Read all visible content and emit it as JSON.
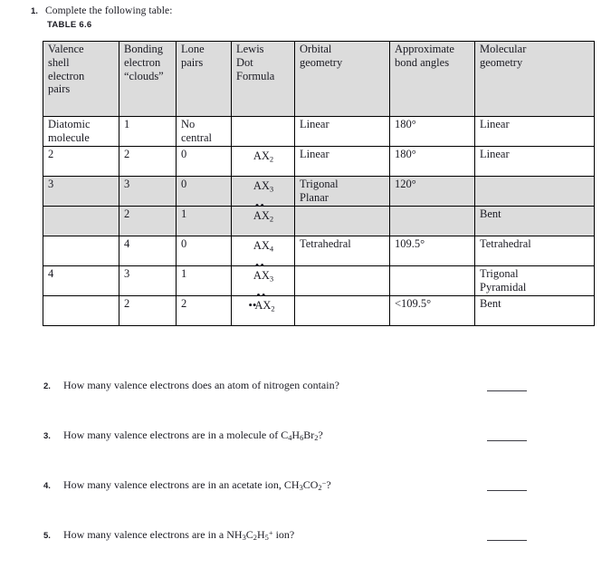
{
  "question1": {
    "number": "1.",
    "prompt": "Complete the following table:",
    "table_caption": "TABLE 6.6"
  },
  "table": {
    "headers": [
      [
        "Valence",
        "shell",
        "electron",
        "pairs"
      ],
      [
        "Bonding",
        "electron",
        "“clouds”"
      ],
      [
        "Lone",
        "pairs"
      ],
      [
        "Lewis",
        "Dot",
        "Formula"
      ],
      [
        "Orbital",
        "geometry"
      ],
      [
        "Approximate",
        "bond angles"
      ],
      [
        "Molecular",
        "geometry"
      ]
    ],
    "rows": [
      {
        "shaded": false,
        "valence_shell_pairs": [
          "Diatomic",
          "molecule"
        ],
        "bonding_clouds": [
          "1"
        ],
        "lone_pairs": [
          "No",
          "central"
        ],
        "lewis": {
          "left_dots": "",
          "top_dots": "",
          "core": "",
          "sub": ""
        },
        "orbital_geometry": [
          "Linear"
        ],
        "bond_angles": [
          "180°"
        ],
        "molecular_geometry": [
          "Linear"
        ]
      },
      {
        "shaded": false,
        "valence_shell_pairs": [
          "2"
        ],
        "bonding_clouds": [
          "2"
        ],
        "lone_pairs": [
          "0"
        ],
        "lewis": {
          "left_dots": "",
          "top_dots": "",
          "core": "AX",
          "sub": "2"
        },
        "orbital_geometry": [
          "Linear"
        ],
        "bond_angles": [
          "180°"
        ],
        "molecular_geometry": [
          "Linear"
        ]
      },
      {
        "shaded": true,
        "valence_shell_pairs": [
          "3"
        ],
        "bonding_clouds": [
          "3"
        ],
        "lone_pairs": [
          "0"
        ],
        "lewis": {
          "left_dots": "",
          "top_dots": "",
          "core": "AX",
          "sub": "3"
        },
        "orbital_geometry": [
          "Trigonal",
          "Planar"
        ],
        "bond_angles": [
          "120°"
        ],
        "molecular_geometry": [
          ""
        ]
      },
      {
        "shaded": true,
        "valence_shell_pairs": [
          ""
        ],
        "bonding_clouds": [
          "2"
        ],
        "lone_pairs": [
          "1"
        ],
        "lewis": {
          "left_dots": "",
          "top_dots": "••",
          "core": "AX",
          "sub": "2"
        },
        "orbital_geometry": [
          ""
        ],
        "bond_angles": [
          ""
        ],
        "molecular_geometry": [
          "Bent"
        ]
      },
      {
        "shaded": false,
        "valence_shell_pairs": [
          ""
        ],
        "bonding_clouds": [
          "4"
        ],
        "lone_pairs": [
          "0"
        ],
        "lewis": {
          "left_dots": "",
          "top_dots": "",
          "core": "AX",
          "sub": "4"
        },
        "orbital_geometry": [
          "Tetrahedral"
        ],
        "bond_angles": [
          "109.5°"
        ],
        "molecular_geometry": [
          "Tetrahedral"
        ]
      },
      {
        "shaded": false,
        "valence_shell_pairs": [
          "4"
        ],
        "bonding_clouds": [
          "3"
        ],
        "lone_pairs": [
          "1"
        ],
        "lewis": {
          "left_dots": "",
          "top_dots": "••",
          "core": "AX",
          "sub": "3"
        },
        "orbital_geometry": [
          ""
        ],
        "bond_angles": [
          ""
        ],
        "molecular_geometry": [
          "Trigonal",
          "Pyramidal"
        ]
      },
      {
        "shaded": false,
        "valence_shell_pairs": [
          ""
        ],
        "bonding_clouds": [
          "2"
        ],
        "lone_pairs": [
          "2"
        ],
        "lewis": {
          "left_dots": "••",
          "top_dots": "••",
          "core": "AX",
          "sub": "2"
        },
        "orbital_geometry": [
          ""
        ],
        "bond_angles": [
          "<109.5°"
        ],
        "molecular_geometry": [
          "Bent"
        ]
      }
    ]
  },
  "questions": [
    {
      "number": "2.",
      "parts": [
        {
          "t": "How many valence electrons does an atom of nitrogen contain?"
        }
      ],
      "answer": ""
    },
    {
      "number": "3.",
      "parts": [
        {
          "t": "How many valence electrons are in a molecule of C"
        },
        {
          "t": "4",
          "k": "sub"
        },
        {
          "t": "H"
        },
        {
          "t": "6",
          "k": "sub"
        },
        {
          "t": "Br"
        },
        {
          "t": "2",
          "k": "sub"
        },
        {
          "t": "?"
        }
      ],
      "answer": ""
    },
    {
      "number": "4.",
      "parts": [
        {
          "t": "How many valence electrons are in an acetate ion, CH"
        },
        {
          "t": "3",
          "k": "sub"
        },
        {
          "t": "CO"
        },
        {
          "t": "2",
          "k": "sub"
        },
        {
          "t": "−",
          "k": "sup"
        },
        {
          "t": "?"
        }
      ],
      "answer": ""
    },
    {
      "number": "5.",
      "parts": [
        {
          "t": "How many valence electrons are in a NH"
        },
        {
          "t": "3",
          "k": "sub"
        },
        {
          "t": "C"
        },
        {
          "t": "2",
          "k": "sub"
        },
        {
          "t": "H"
        },
        {
          "t": "5",
          "k": "sub"
        },
        {
          "t": "+",
          "k": "sup"
        },
        {
          "t": " ion?"
        }
      ],
      "answer": ""
    }
  ],
  "colors": {
    "shade": "#dcdcdc",
    "border": "#000000",
    "text": "#1a1a22",
    "blank_rule": "#3b3b44"
  }
}
